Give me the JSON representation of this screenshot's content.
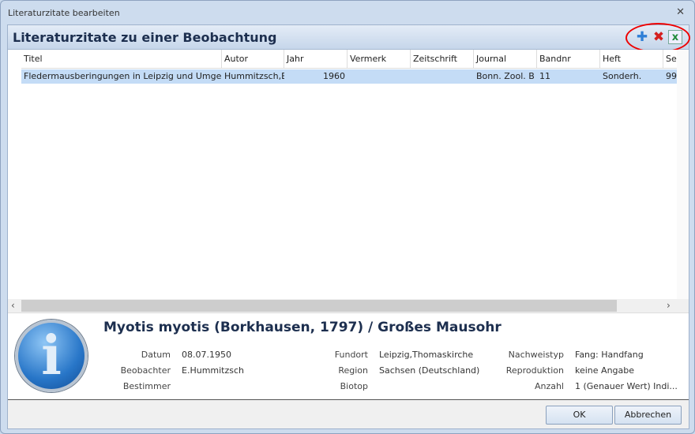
{
  "window": {
    "title": "Literaturzitate bearbeiten",
    "close": "☒"
  },
  "header": {
    "title": "Literaturzitate zu einer Beobachtung",
    "icons": [
      "add-icon",
      "delete-icon",
      "excel-export-icon"
    ]
  },
  "grid": {
    "columns": [
      "Titel",
      "Autor",
      "Jahr",
      "Vermerk",
      "Zeitschrift",
      "Journal",
      "Bandnr",
      "Heft",
      "Se"
    ],
    "rows": [
      [
        "Fledermausberingungen in Leipzig und Umgebu",
        "Hummitzsch,E",
        "1960",
        "",
        "",
        "Bonn. Zool. B",
        "11",
        "Sonderh.",
        "99"
      ]
    ]
  },
  "info": {
    "species": "Myotis myotis (Borkhausen, 1797) / Großes Mausohr",
    "fields": [
      {
        "label": "Datum",
        "value": "08.07.1950"
      },
      {
        "label": "Beobachter",
        "value": "E.Hummitzsch"
      },
      {
        "label": "Bestimmer",
        "value": ""
      },
      {
        "label": "Fundort",
        "value": "Leipzig,Thomaskirche"
      },
      {
        "label": "Region",
        "value": "Sachsen (Deutschland)"
      },
      {
        "label": "Biotop",
        "value": ""
      },
      {
        "label": "Nachweistyp",
        "value": "Fang: Handfang"
      },
      {
        "label": "Reproduktion",
        "value": "keine Angabe"
      },
      {
        "label": "Anzahl",
        "value": "1 (Genauer Wert) Indi..."
      }
    ]
  },
  "footer": {
    "ok": "OK",
    "cancel": "Abbrechen"
  },
  "colors": {
    "selection": "#c4dcf6",
    "highlight_circle": "#e00000",
    "title_text": "#1d2f4f"
  }
}
